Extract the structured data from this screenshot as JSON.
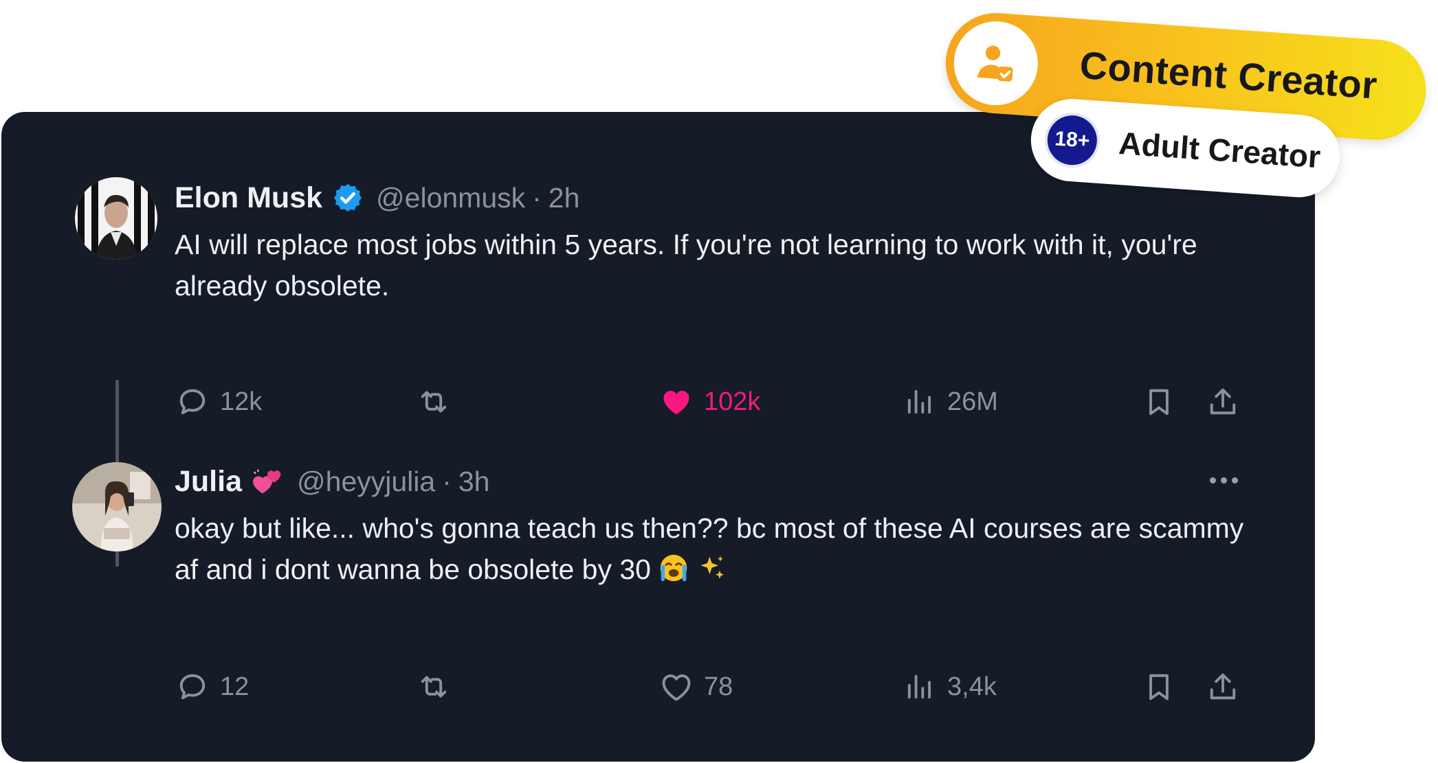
{
  "badges": {
    "primary_label": "Content Creator",
    "secondary_label": "Adult Creator",
    "secondary_tag": "18+"
  },
  "tweets": [
    {
      "name": "Elon Musk",
      "handle": "@elonmusk",
      "separator": "·",
      "time": "2h",
      "text": "AI will replace most jobs within 5 years. If you're not learning to work with it, you're already obsolete.",
      "verified": true,
      "stats": {
        "replies": "12k",
        "likes": "102k",
        "views": "26M"
      },
      "liked": true
    },
    {
      "name": "Julia",
      "handle": "@heyyjulia",
      "separator": "·",
      "time": "3h",
      "text": "okay but like... who's gonna teach us then?? bc most of these AI courses are scammy af and i dont wanna be obsolete by 30",
      "name_emoji": "two-hearts-emoji",
      "trailing_emoji": [
        "crying-face-emoji",
        "sparkles-emoji"
      ],
      "stats": {
        "replies": "12",
        "likes": "78",
        "views": "3,4k"
      },
      "liked": false
    }
  ],
  "colors": {
    "card_bg": "#151c28",
    "like_active": "#f91880",
    "verified": "#1d9bf0",
    "muted": "#8a929c"
  }
}
